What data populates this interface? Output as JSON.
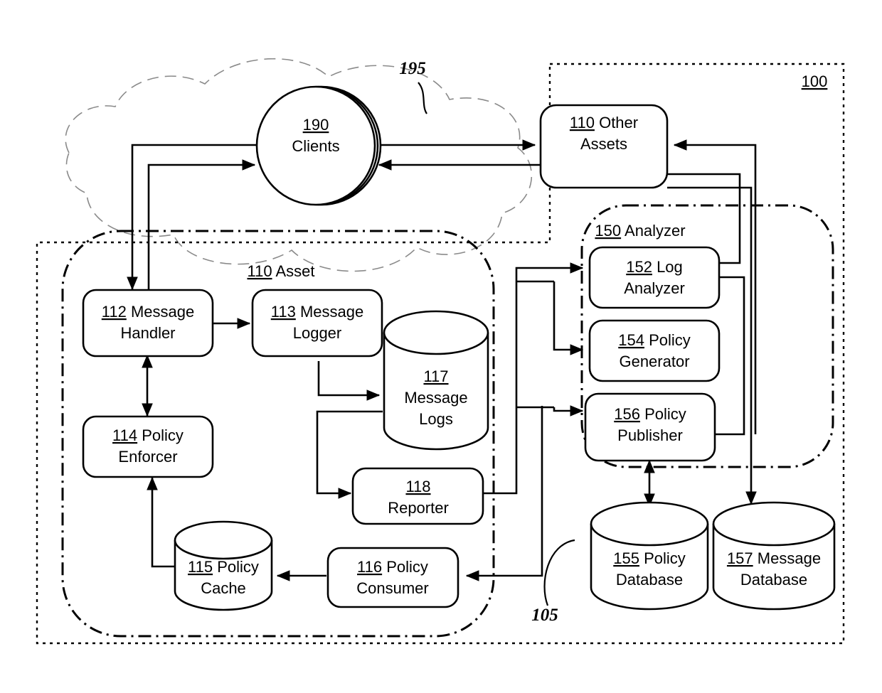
{
  "figure": {
    "type": "patent-block-diagram",
    "callouts": [
      {
        "id": "c195",
        "text": "195"
      },
      {
        "id": "c105",
        "text": "105"
      }
    ],
    "regions": [
      {
        "id": "system",
        "ref": "100",
        "label": "",
        "style": "dotted-rectangle"
      },
      {
        "id": "asset",
        "ref": "110",
        "label": "Asset",
        "style": "dash-dot-rounded"
      },
      {
        "id": "analyzer",
        "ref": "150",
        "label": "Analyzer",
        "style": "dash-dot-rounded"
      },
      {
        "id": "network",
        "ref": "195",
        "label": "",
        "style": "cloud"
      }
    ],
    "region_titles": {
      "system": "100",
      "asset_ref": "110",
      "asset_name": "Asset",
      "analyzer_ref": "150",
      "analyzer_name": "Analyzer"
    },
    "nodes": [
      {
        "id": "clients",
        "ref": "190",
        "line1": "Clients",
        "line2": "",
        "shape": "stacked-circle"
      },
      {
        "id": "other",
        "ref": "110",
        "line1": "Other",
        "line2": "Assets",
        "shape": "rounded-rect",
        "inline": true
      },
      {
        "id": "handler",
        "ref": "112",
        "line1": "Message",
        "line2": "Handler",
        "shape": "rounded-rect",
        "inline": true
      },
      {
        "id": "logger",
        "ref": "113",
        "line1": "Message",
        "line2": "Logger",
        "shape": "rounded-rect",
        "inline": true
      },
      {
        "id": "enforcer",
        "ref": "114",
        "line1": "Policy",
        "line2": "Enforcer",
        "shape": "rounded-rect",
        "inline": true
      },
      {
        "id": "msglogs",
        "ref": "117",
        "line1": "Message",
        "line2": "Logs",
        "shape": "cylinder",
        "inline": false
      },
      {
        "id": "reporter",
        "ref": "118",
        "line1": "Reporter",
        "line2": "",
        "shape": "rounded-rect",
        "inline": false
      },
      {
        "id": "pcache",
        "ref": "115",
        "line1": "Policy",
        "line2": "Cache",
        "shape": "cylinder",
        "inline": true
      },
      {
        "id": "pconsumer",
        "ref": "116",
        "line1": "Policy",
        "line2": "Consumer",
        "shape": "rounded-rect",
        "inline": true
      },
      {
        "id": "loganal",
        "ref": "152",
        "line1": "Log",
        "line2": "Analyzer",
        "shape": "rounded-rect",
        "inline": true
      },
      {
        "id": "pgen",
        "ref": "154",
        "line1": "Policy",
        "line2": "Generator",
        "shape": "rounded-rect",
        "inline": true
      },
      {
        "id": "ppub",
        "ref": "156",
        "line1": "Policy",
        "line2": "Publisher",
        "shape": "rounded-rect",
        "inline": true
      },
      {
        "id": "pdb",
        "ref": "155",
        "line1": "Policy",
        "line2": "Database",
        "shape": "cylinder",
        "inline": true
      },
      {
        "id": "mdb",
        "ref": "157",
        "line1": "Message",
        "line2": "Database",
        "shape": "cylinder",
        "inline": true
      }
    ],
    "node_text": {
      "clients": {
        "ref": "190",
        "l1": "Clients",
        "l2": ""
      },
      "other": {
        "ref": "110",
        "l1": "Other",
        "l2": "Assets"
      },
      "handler": {
        "ref": "112",
        "l1": "Message",
        "l2": "Handler"
      },
      "logger": {
        "ref": "113",
        "l1": "Message",
        "l2": "Logger"
      },
      "enforcer": {
        "ref": "114",
        "l1": "Policy",
        "l2": "Enforcer"
      },
      "msglogs": {
        "ref": "117",
        "l1": "Message",
        "l2": "Logs"
      },
      "reporter": {
        "ref": "118",
        "l1": "Reporter",
        "l2": ""
      },
      "pcache": {
        "ref": "115",
        "l1": "Policy",
        "l2": "Cache"
      },
      "pconsumer": {
        "ref": "116",
        "l1": "Policy",
        "l2": "Consumer"
      },
      "loganal": {
        "ref": "152",
        "l1": "Log",
        "l2": "Analyzer"
      },
      "pgen": {
        "ref": "154",
        "l1": "Policy",
        "l2": "Generator"
      },
      "ppub": {
        "ref": "156",
        "l1": "Policy",
        "l2": "Publisher"
      },
      "pdb": {
        "ref": "155",
        "l1": "Policy",
        "l2": "Database"
      },
      "mdb": {
        "ref": "157",
        "l1": "Message",
        "l2": "Database"
      }
    },
    "edges": [
      {
        "from": "clients",
        "to": "other",
        "arrow": "single"
      },
      {
        "from": "other",
        "to": "clients",
        "arrow": "single"
      },
      {
        "from": "clients",
        "to": "handler",
        "arrow": "single"
      },
      {
        "from": "handler",
        "to": "clients",
        "arrow": "single"
      },
      {
        "from": "handler",
        "to": "logger",
        "arrow": "single"
      },
      {
        "from": "handler",
        "to": "enforcer",
        "arrow": "double"
      },
      {
        "from": "logger",
        "to": "msglogs",
        "arrow": "single"
      },
      {
        "from": "msglogs",
        "to": "reporter",
        "arrow": "single"
      },
      {
        "from": "pcache",
        "to": "enforcer",
        "arrow": "single"
      },
      {
        "from": "pconsumer",
        "to": "pcache",
        "arrow": "single"
      },
      {
        "from": "reporter",
        "to": "loganal",
        "arrow": "single"
      },
      {
        "from": "reporter",
        "to": "pgen",
        "arrow": "single"
      },
      {
        "from": "reporter",
        "to": "ppub",
        "arrow": "single"
      },
      {
        "from": "ppub",
        "to": "pconsumer",
        "arrow": "single"
      },
      {
        "from": "ppub",
        "to": "loganal",
        "arrow": "single"
      },
      {
        "from": "ppub",
        "to": "pdb",
        "arrow": "double"
      },
      {
        "from": "other",
        "to": "loganal",
        "arrow": "single"
      },
      {
        "from": "other",
        "to": "mdb",
        "arrow": "single"
      },
      {
        "from": "ppub",
        "to": "other",
        "arrow": "single"
      }
    ],
    "colors": {
      "stroke": "#000000",
      "background": "#ffffff",
      "cloud_stroke": "#8a8a8a"
    }
  }
}
